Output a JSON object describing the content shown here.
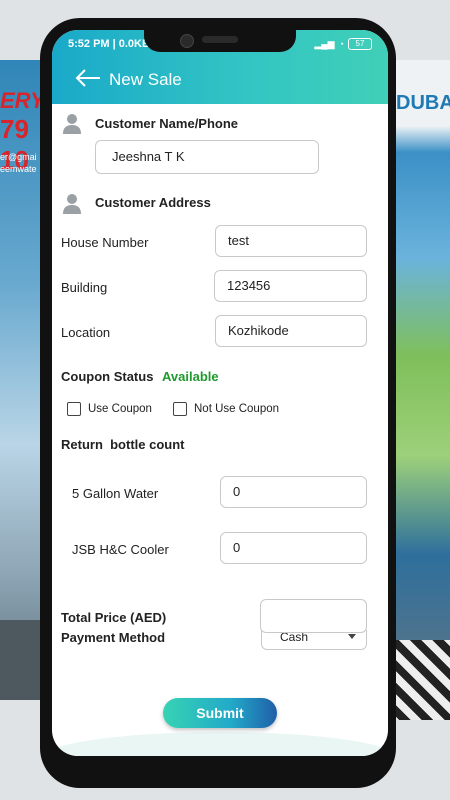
{
  "status_bar": {
    "time": "5:52 PM | 0.0KB",
    "battery": "57"
  },
  "header": {
    "title": "New Sale"
  },
  "customer": {
    "name_label": "Customer Name/Phone",
    "name_value": "Jeeshna T K",
    "address_label": "Customer Address"
  },
  "address": {
    "house_label": "House Number",
    "house_value": "test",
    "building_label": "Building",
    "building_value": "123456",
    "location_label": "Location",
    "location_value": "Kozhikode"
  },
  "coupon": {
    "status_label": "Coupon Status",
    "status_value": "Available",
    "use_label": "Use Coupon",
    "not_use_label": "Not Use Coupon"
  },
  "return_bottles": {
    "title": "Return  bottle count",
    "items": [
      {
        "label": "5 Gallon Water",
        "value": "0"
      },
      {
        "label": "JSB H&C Cooler",
        "value": "0"
      }
    ]
  },
  "total": {
    "label": "Total Price (AED)",
    "value": ""
  },
  "payment": {
    "label": "Payment Method",
    "selected": "Cash"
  },
  "submit_label": "Submit",
  "background": {
    "left_brand": "ERY",
    "left_number": "79 10",
    "left_email": "er@gmai",
    "left_web": "eemwate",
    "right_brand": "DUBA"
  },
  "colors": {
    "header_start": "#1aa9c9",
    "header_end": "#40cfb7",
    "available_green": "#1f9a2e"
  }
}
